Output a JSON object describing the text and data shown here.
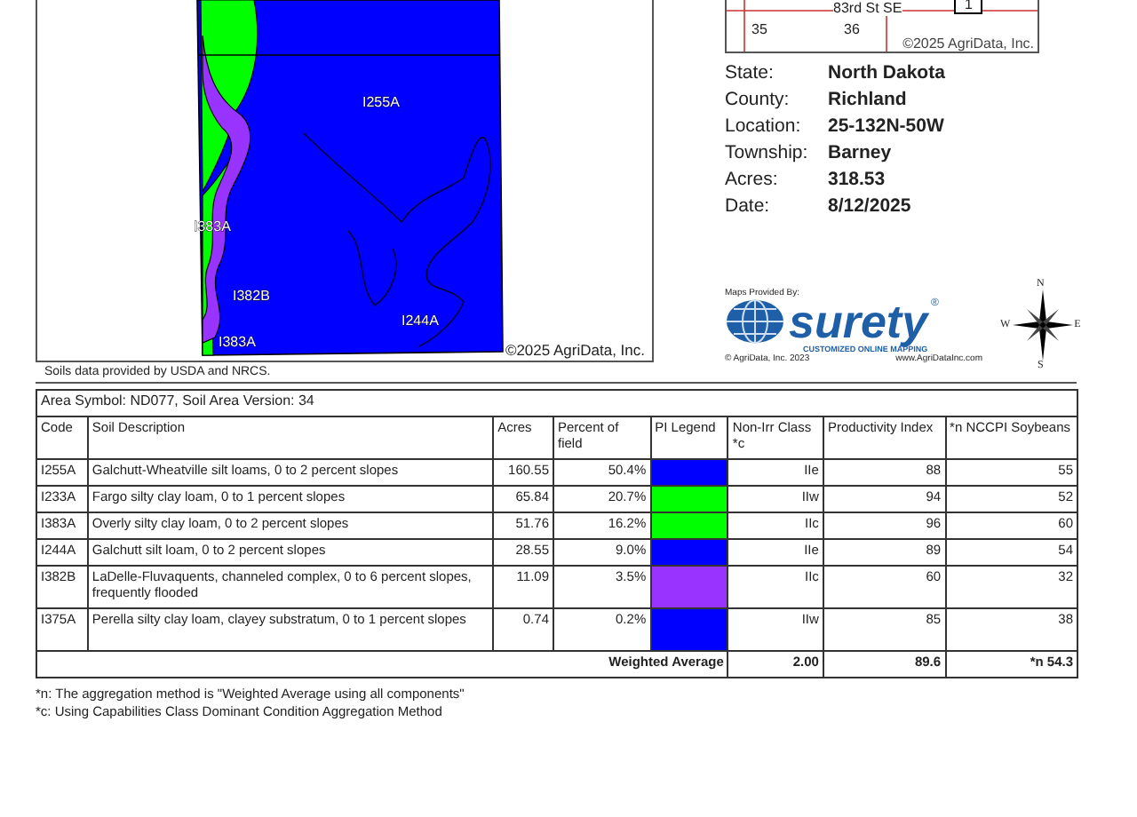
{
  "map": {
    "labels": [
      "I255A",
      "I383A",
      "I382B",
      "I244A",
      "I383A"
    ],
    "copyright": "©2025 AgriData, Inc."
  },
  "inset_map": {
    "road": "83rd St SE",
    "marker": "1",
    "sections": [
      "35",
      "36"
    ],
    "copyright": "©2025 AgriData, Inc."
  },
  "info": [
    {
      "label": "State:",
      "value": "North Dakota"
    },
    {
      "label": "County:",
      "value": "Richland"
    },
    {
      "label": "Location:",
      "value": "25-132N-50W"
    },
    {
      "label": "Township:",
      "value": "Barney"
    },
    {
      "label": "Acres:",
      "value": "318.53"
    },
    {
      "label": "Date:",
      "value": "8/12/2025"
    }
  ],
  "logo": {
    "caption": "Maps Provided By:",
    "brand": "surety",
    "registered": "®",
    "tagline": "CUSTOMIZED ONLINE MAPPING",
    "copyright": "© AgriData, Inc. 2023",
    "website": "www.AgriDataInc.com"
  },
  "compass": {
    "n": "N",
    "e": "E",
    "s": "S",
    "w": "W"
  },
  "source_note": "Soils data provided by USDA and NRCS.",
  "table": {
    "area": "Area Symbol: ND077, Soil Area Version: 34",
    "columns": [
      "Code",
      "Soil Description",
      "Acres",
      "Percent of field",
      "PI Legend",
      "Non-Irr Class *c",
      "Productivity Index",
      "*n NCCPI Soybeans"
    ],
    "rows": [
      {
        "code": "I255A",
        "description": "Galchutt-Wheatville silt loams, 0 to 2 percent slopes",
        "acres": "160.55",
        "percent": "50.4%",
        "color": "#0000ff",
        "class": "IIe",
        "pi": "88",
        "nccpi": "55"
      },
      {
        "code": "I233A",
        "description": "Fargo silty clay loam, 0 to 1 percent slopes",
        "acres": "65.84",
        "percent": "20.7%",
        "color": "#00ff00",
        "class": "IIw",
        "pi": "94",
        "nccpi": "52"
      },
      {
        "code": "I383A",
        "description": "Overly silty clay loam, 0 to 2 percent slopes",
        "acres": "51.76",
        "percent": "16.2%",
        "color": "#00ff00",
        "class": "IIc",
        "pi": "96",
        "nccpi": "60"
      },
      {
        "code": "I244A",
        "description": "Galchutt silt loam, 0 to 2 percent slopes",
        "acres": "28.55",
        "percent": "9.0%",
        "color": "#0000ff",
        "class": "IIe",
        "pi": "89",
        "nccpi": "54"
      },
      {
        "code": "I382B",
        "description": "LaDelle-Fluvaquents, channeled complex, 0 to 6 percent slopes, frequently flooded",
        "acres": "11.09",
        "percent": "3.5%",
        "color": "#9933ff",
        "class": "IIc",
        "pi": "60",
        "nccpi": "32"
      },
      {
        "code": "I375A",
        "description": "Perella silty clay loam, clayey substratum, 0 to 1 percent slopes",
        "acres": "0.74",
        "percent": "0.2%",
        "color": "#0000ff",
        "class": "IIw",
        "pi": "85",
        "nccpi": "38"
      }
    ],
    "weighted": {
      "label": "Weighted Average",
      "class": "2.00",
      "pi": "89.6",
      "nccpi": "*n 54.3"
    }
  },
  "footnotes": [
    "*n: The aggregation method is \"Weighted Average using all components\"",
    "*c: Using Capabilities Class Dominant Condition Aggregation Method"
  ]
}
